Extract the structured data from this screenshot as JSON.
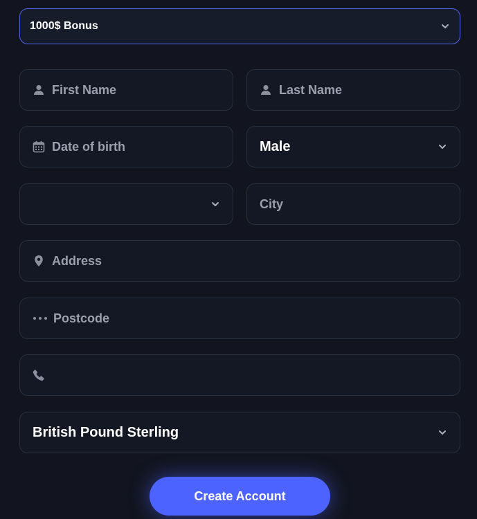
{
  "colors": {
    "background": "#12151f",
    "field_bg": "#141824",
    "field_border": "#2a2f3d",
    "accent": "#4d63ff",
    "accent_border": "#4f63f0",
    "placeholder": "#9aa0ad",
    "text": "#ffffff"
  },
  "bonus": {
    "selected": "1000$ Bonus"
  },
  "name": {
    "first_placeholder": "First Name",
    "last_placeholder": "Last Name"
  },
  "dob": {
    "placeholder": "Date of birth"
  },
  "gender": {
    "selected": "Male"
  },
  "country": {
    "selected": ""
  },
  "city": {
    "placeholder": "City"
  },
  "address": {
    "placeholder": "Address"
  },
  "postcode": {
    "placeholder": "Postcode"
  },
  "phone": {
    "value": ""
  },
  "currency": {
    "selected": "British Pound Sterling"
  },
  "submit": {
    "label": "Create Account"
  },
  "icons": {
    "first": "user-icon",
    "last": "user-icon",
    "dob": "calendar-icon",
    "address": "map-pin-icon",
    "postcode": "dots-icon",
    "phone": "phone-icon",
    "chevron": "chevron-down-icon"
  }
}
